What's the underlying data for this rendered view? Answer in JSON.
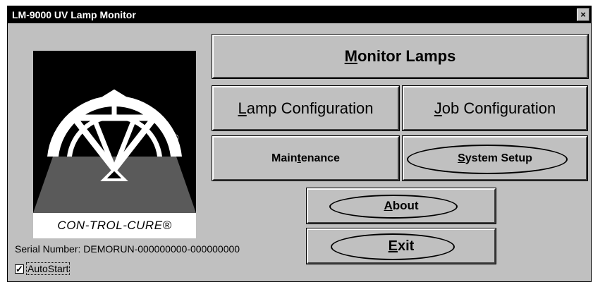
{
  "window": {
    "title": "LM-9000 UV Lamp Monitor",
    "close_glyph": "×"
  },
  "buttons": {
    "monitor_lamps": {
      "prefix": "",
      "mnemonic": "M",
      "rest": "onitor Lamps"
    },
    "lamp_configuration": {
      "prefix": "",
      "mnemonic": "L",
      "rest": "amp Configuration"
    },
    "job_configuration": {
      "prefix": "",
      "mnemonic": "J",
      "rest": "ob Configuration"
    },
    "maintenance": {
      "prefix": "Main",
      "mnemonic": "t",
      "rest": "enance"
    },
    "system_setup": {
      "prefix": "",
      "mnemonic": "S",
      "rest": "ystem Setup"
    },
    "about": {
      "prefix": "",
      "mnemonic": "A",
      "rest": "bout"
    },
    "exit": {
      "prefix": "",
      "mnemonic": "E",
      "rest": "xit"
    }
  },
  "logo": {
    "label": "CON-TROL-CURE®",
    "registered_mark": "®"
  },
  "serial": {
    "text": "Serial Number: DEMORUN-000000000-000000000"
  },
  "autostart": {
    "label": "AutoStart",
    "checked": true,
    "check_glyph": "✓"
  }
}
